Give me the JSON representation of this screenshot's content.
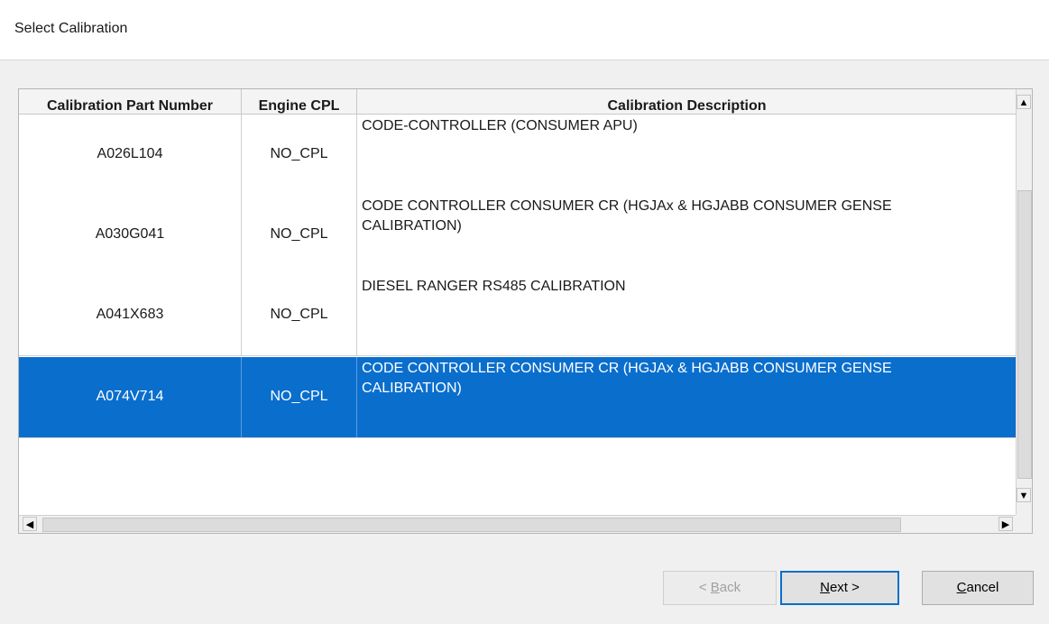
{
  "window": {
    "title": "Select Calibration"
  },
  "grid": {
    "columns": [
      "Calibration Part Number",
      "Engine CPL",
      "Calibration Description"
    ],
    "rows": [
      {
        "part_number": "A026L104",
        "cpl": "NO_CPL",
        "description": "CODE-CONTROLLER (CONSUMER APU)",
        "selected": false
      },
      {
        "part_number": "A030G041",
        "cpl": "NO_CPL",
        "description": "CODE CONTROLLER CONSUMER CR (HGJAx & HGJABB CONSUMER GENSE\nCALIBRATION)",
        "selected": false
      },
      {
        "part_number": "A041X683",
        "cpl": "NO_CPL",
        "description": "DIESEL RANGER RS485 CALIBRATION",
        "selected": false
      },
      {
        "part_number": "A074V714",
        "cpl": "NO_CPL",
        "description": "CODE CONTROLLER CONSUMER CR (HGJAx & HGJABB CONSUMER GENSE\nCALIBRATION)",
        "selected": true
      }
    ],
    "scroll_up_icon": "triangle-up",
    "scroll_down_icon": "triangle-down",
    "scroll_left_icon": "triangle-left",
    "scroll_right_icon": "triangle-right",
    "selection_color": "#0a6ecd"
  },
  "buttons": {
    "back": {
      "prefix": "< ",
      "accel": "B",
      "rest": "ack"
    },
    "next": {
      "accel": "N",
      "rest": "ext >"
    },
    "cancel": {
      "accel": "C",
      "rest": "ancel"
    }
  }
}
